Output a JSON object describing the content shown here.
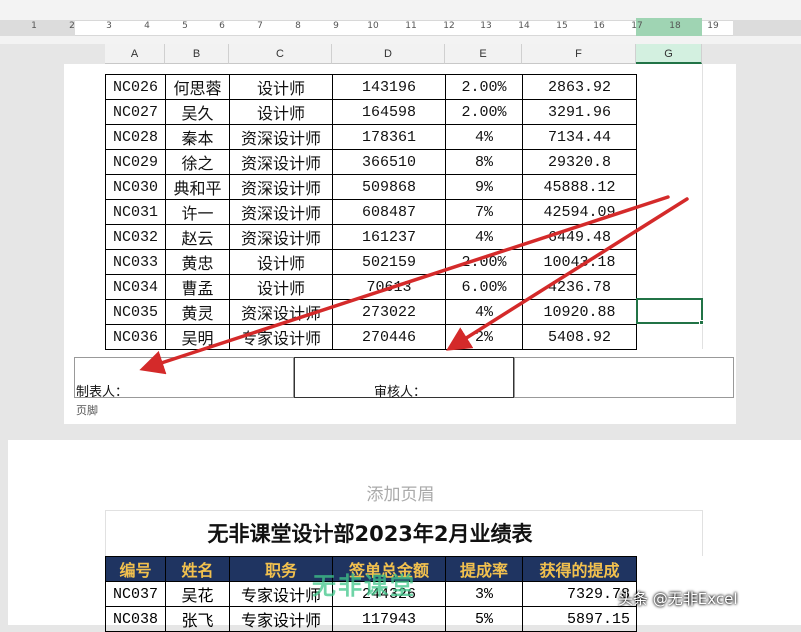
{
  "ruler": {
    "numbers": [
      "1",
      "2",
      "3",
      "4",
      "5",
      "6",
      "7",
      "8",
      "9",
      "10",
      "11",
      "12",
      "13",
      "14",
      "15",
      "16",
      "17",
      "18",
      "19"
    ]
  },
  "columns": [
    "A",
    "B",
    "C",
    "D",
    "E",
    "F",
    "G"
  ],
  "page1": {
    "rows": [
      {
        "id": "NC026",
        "name": "何思蓉",
        "title": "设计师",
        "amount": "143196",
        "rate": "2.00%",
        "commission": "2863.92"
      },
      {
        "id": "NC027",
        "name": "吴久",
        "title": "设计师",
        "amount": "164598",
        "rate": "2.00%",
        "commission": "3291.96"
      },
      {
        "id": "NC028",
        "name": "秦本",
        "title": "资深设计师",
        "amount": "178361",
        "rate": "4%",
        "commission": "7134.44"
      },
      {
        "id": "NC029",
        "name": "徐之",
        "title": "资深设计师",
        "amount": "366510",
        "rate": "8%",
        "commission": "29320.8"
      },
      {
        "id": "NC030",
        "name": "典和平",
        "title": "资深设计师",
        "amount": "509868",
        "rate": "9%",
        "commission": "45888.12"
      },
      {
        "id": "NC031",
        "name": "许一",
        "title": "资深设计师",
        "amount": "608487",
        "rate": "7%",
        "commission": "42594.09"
      },
      {
        "id": "NC032",
        "name": "赵云",
        "title": "资深设计师",
        "amount": "161237",
        "rate": "4%",
        "commission": "6449.48"
      },
      {
        "id": "NC033",
        "name": "黄忠",
        "title": "设计师",
        "amount": "502159",
        "rate": "2.00%",
        "commission": "10043.18"
      },
      {
        "id": "NC034",
        "name": "曹孟",
        "title": "设计师",
        "amount": "70613",
        "rate": "6.00%",
        "commission": "4236.78"
      },
      {
        "id": "NC035",
        "name": "黄灵",
        "title": "资深设计师",
        "amount": "273022",
        "rate": "4%",
        "commission": "10920.88"
      },
      {
        "id": "NC036",
        "name": "吴明",
        "title": "专家设计师",
        "amount": "270446",
        "rate": "2%",
        "commission": "5408.92"
      }
    ],
    "footer": {
      "preparer": "制表人：",
      "reviewer": "审核人：",
      "label": "页脚"
    }
  },
  "page2": {
    "add_header": "添加页眉",
    "title": "无非课堂设计部2023年2月业绩表",
    "headers": [
      "编号",
      "姓名",
      "职务",
      "签单总金额",
      "提成率",
      "获得的提成"
    ],
    "rows": [
      {
        "id": "NC037",
        "name": "吴花",
        "title": "专家设计师",
        "amount": "244326",
        "rate": "3%",
        "commission": "7329.78"
      },
      {
        "id": "NC038",
        "name": "张飞",
        "title": "专家设计师",
        "amount": "117943",
        "rate": "5%",
        "commission": "5897.15"
      }
    ]
  },
  "watermark": "无非课堂",
  "credit": "头条 @无非Excel",
  "colors": {
    "header_bg": "#1f3461",
    "header_text": "#f2c14e",
    "arrow": "#d42a2a",
    "selection": "#217346"
  }
}
